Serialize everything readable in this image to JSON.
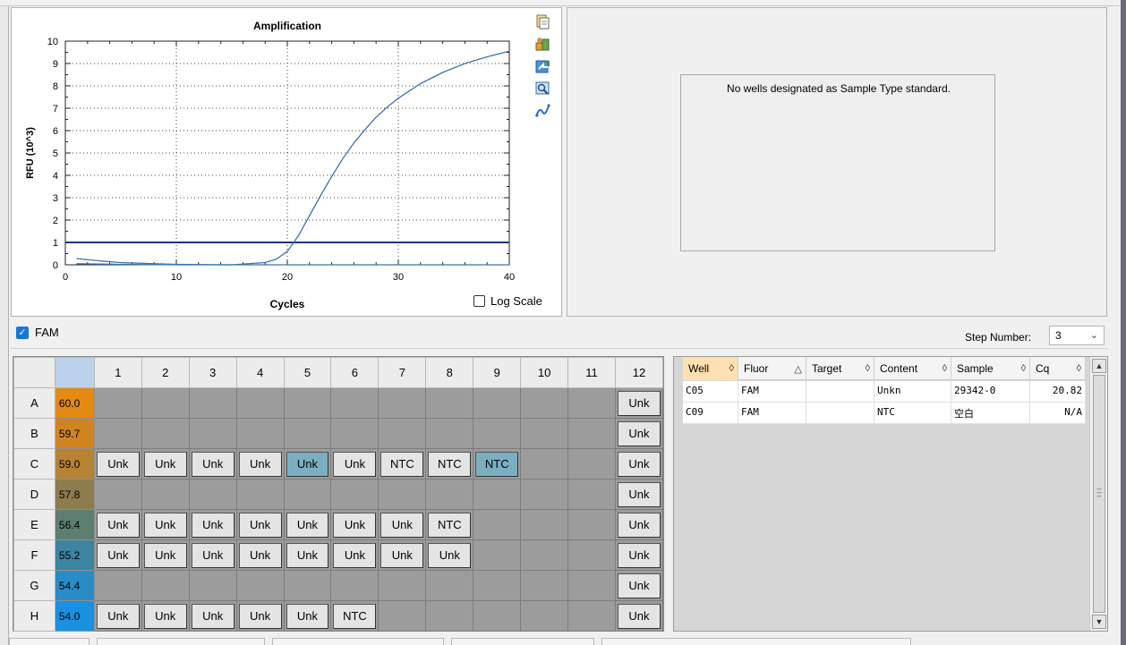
{
  "chart": {
    "title": "Amplification",
    "xlabel": "Cycles",
    "ylabel": "RFU (10^3)",
    "log_scale_label": "Log Scale",
    "log_scale_checked": false,
    "toolbar_icons": [
      "copy-icon",
      "export-icon",
      "export-image-icon",
      "zoom-icon",
      "trace-style-icon"
    ]
  },
  "chart_data": {
    "type": "line",
    "xlim": [
      0,
      40
    ],
    "ylim": [
      0,
      10
    ],
    "xticks": [
      0,
      10,
      20,
      30,
      40
    ],
    "yticks": [
      0,
      1,
      2,
      3,
      4,
      5,
      6,
      7,
      8,
      9,
      10
    ],
    "grid": true,
    "threshold": 1.0,
    "series": [
      {
        "x": [
          1,
          5,
          10,
          15,
          18,
          19,
          20,
          21,
          22,
          23,
          24,
          25,
          26,
          27,
          28,
          29,
          30,
          32,
          34,
          36,
          38,
          40
        ],
        "y": [
          0.05,
          0.02,
          0.0,
          0.0,
          0.1,
          0.25,
          0.6,
          1.3,
          2.2,
          3.1,
          3.95,
          4.75,
          5.45,
          6.05,
          6.6,
          7.05,
          7.45,
          8.1,
          8.6,
          9.0,
          9.3,
          9.55
        ]
      },
      {
        "x": [
          1,
          3,
          5,
          8,
          10,
          15,
          20,
          25,
          30,
          35,
          40
        ],
        "y": [
          0.28,
          0.18,
          0.1,
          0.05,
          0.02,
          0.0,
          0.0,
          0.0,
          0.0,
          0.0,
          0.0
        ]
      }
    ]
  },
  "standard_panel": {
    "message": "No wells designated as Sample Type standard."
  },
  "fluor": {
    "label": "FAM",
    "checked": true
  },
  "step": {
    "label": "Step Number:",
    "value": "3"
  },
  "plate": {
    "columns": [
      "1",
      "2",
      "3",
      "4",
      "5",
      "6",
      "7",
      "8",
      "9",
      "10",
      "11",
      "12"
    ],
    "rows": [
      {
        "label": "A",
        "temp": "60.0",
        "color": "#e28a12",
        "cells": [
          "",
          "",
          "",
          "",
          "",
          "",
          "",
          "",
          "",
          "",
          "",
          "Unk"
        ]
      },
      {
        "label": "B",
        "temp": "59.7",
        "color": "#d08420",
        "cells": [
          "",
          "",
          "",
          "",
          "",
          "",
          "",
          "",
          "",
          "",
          "",
          "Unk"
        ]
      },
      {
        "label": "C",
        "temp": "59.0",
        "color": "#b88234",
        "cells": [
          "Unk",
          "Unk",
          "Unk",
          "Unk",
          "Unk",
          "Unk",
          "NTC",
          "NTC",
          "NTC",
          "",
          "",
          "Unk"
        ]
      },
      {
        "label": "D",
        "temp": "57.8",
        "color": "#8c7c4e",
        "cells": [
          "",
          "",
          "",
          "",
          "",
          "",
          "",
          "",
          "",
          "",
          "",
          "Unk"
        ]
      },
      {
        "label": "E",
        "temp": "56.4",
        "color": "#5e7e70",
        "cells": [
          "Unk",
          "Unk",
          "Unk",
          "Unk",
          "Unk",
          "Unk",
          "Unk",
          "NTC",
          "",
          "",
          "",
          "Unk"
        ]
      },
      {
        "label": "F",
        "temp": "55.2",
        "color": "#3c84a0",
        "cells": [
          "Unk",
          "Unk",
          "Unk",
          "Unk",
          "Unk",
          "Unk",
          "Unk",
          "Unk",
          "",
          "",
          "",
          "Unk"
        ]
      },
      {
        "label": "G",
        "temp": "54.4",
        "color": "#2a8cc6",
        "cells": [
          "",
          "",
          "",
          "",
          "",
          "",
          "",
          "",
          "",
          "",
          "",
          "Unk"
        ]
      },
      {
        "label": "H",
        "temp": "54.0",
        "color": "#1a90e0",
        "cells": [
          "Unk",
          "Unk",
          "Unk",
          "Unk",
          "Unk",
          "NTC",
          "",
          "",
          "",
          "",
          "",
          "Unk"
        ]
      }
    ]
  },
  "results": {
    "headers": [
      "Well",
      "Fluor",
      "Target",
      "Content",
      "Sample",
      "Cq"
    ],
    "rows": [
      [
        "C05",
        "FAM",
        "",
        "Unkn",
        "29342-0",
        "20.82"
      ],
      [
        "C09",
        "FAM",
        "",
        "NTC",
        "空白",
        "N/A"
      ]
    ]
  }
}
